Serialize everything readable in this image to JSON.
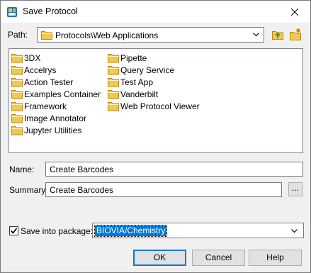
{
  "window": {
    "title": "Save Protocol",
    "close_glyph": "✕"
  },
  "path": {
    "label": "Path:",
    "value": "Protocols\\Web Applications",
    "up_folder_icon": "folder-up-icon",
    "new_folder_icon": "new-folder-icon"
  },
  "folders": {
    "column1": [
      "3DX",
      "Accelrys",
      "Action Tester",
      "Examples Container",
      "Framework",
      "Image Annotator",
      "Jupyter Utilities"
    ],
    "column2": [
      "Pipette",
      "Query Service",
      "Test App",
      "Vanderbilt",
      "Web Protocol Viewer"
    ]
  },
  "name": {
    "label": "Name:",
    "value": "Create Barcodes"
  },
  "summary": {
    "label": "Summary:",
    "value": "Create Barcodes",
    "browse_label": "..."
  },
  "package": {
    "checkbox_label": "Save into package:",
    "checked": true,
    "value": "BIOVIA/Chemistry"
  },
  "buttons": {
    "ok": "OK",
    "cancel": "Cancel",
    "help": "Help"
  },
  "colors": {
    "selection": "#0078d7",
    "folder": "#f2c94c"
  }
}
